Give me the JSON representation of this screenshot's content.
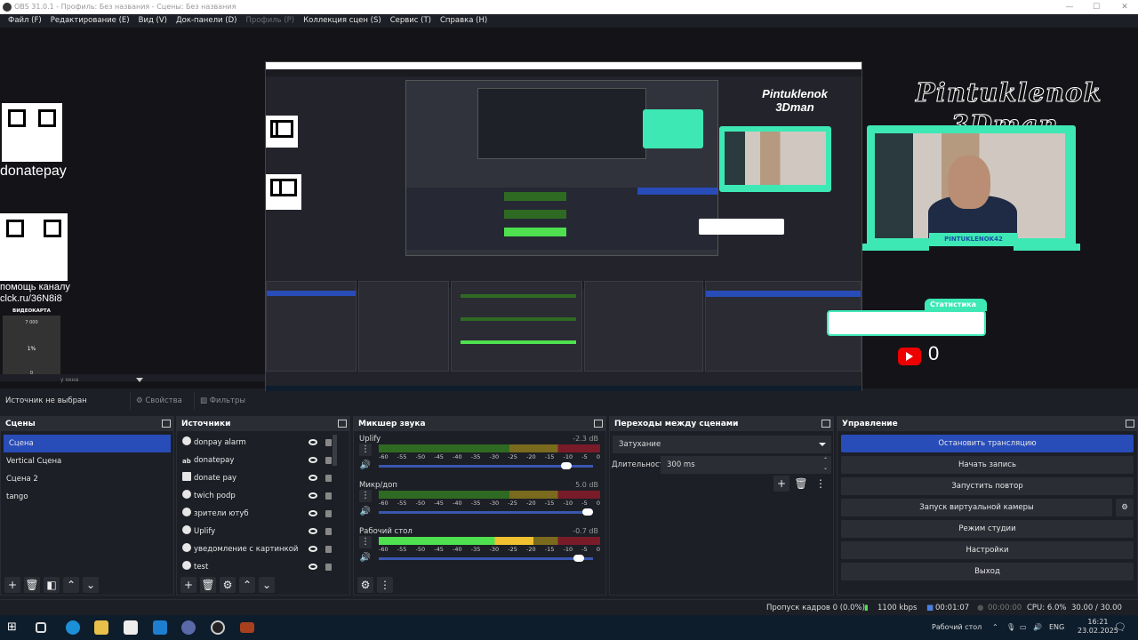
{
  "window": {
    "title": "OBS 31.0.1 - Профиль: Без названия - Сцены: Без названия"
  },
  "menu": [
    {
      "label": "Файл (F)"
    },
    {
      "label": "Редактирование (E)"
    },
    {
      "label": "Вид (V)"
    },
    {
      "label": "Док-панели (D)"
    },
    {
      "label": "Профиль (P)",
      "disabled": true
    },
    {
      "label": "Коллекция сцен (S)"
    },
    {
      "label": "Сервис (T)"
    },
    {
      "label": "Справка (H)"
    }
  ],
  "preview": {
    "qr1_label": "donatepay",
    "qr2_label_1": "помощь каналу",
    "qr2_label_2": "clck.ru/36N8i8",
    "gpu_widget": {
      "title": "ВИДЕОКАРТА",
      "top": "7 000",
      "mid": "1%",
      "bottom": "0"
    },
    "window_fragment": "у окна",
    "logo_line1": "Pintuklenok",
    "logo_line2": "3Dman",
    "cam_label": "PINTUKLENOK42",
    "stats_label": "Статистика",
    "youtube_count": "0",
    "accent": "#3ee8b5"
  },
  "source_row": {
    "no_source": "Источник не выбран",
    "properties": "Свойства",
    "filters": "Фильтры"
  },
  "scenes": {
    "title": "Сцены",
    "items": [
      "Сцена",
      "Vertical Сцена",
      "Сцена 2",
      "tango"
    ],
    "selected": 0
  },
  "sources": {
    "title": "Источники",
    "items": [
      {
        "name": "donpay alarm",
        "icon": "globe-icon"
      },
      {
        "name": "donatepay",
        "icon": "text-icon"
      },
      {
        "name": "donate pay",
        "icon": "image-icon"
      },
      {
        "name": "twich podp",
        "icon": "globe-icon"
      },
      {
        "name": "зрители ютуб",
        "icon": "globe-icon"
      },
      {
        "name": "Uplify",
        "icon": "globe-icon"
      },
      {
        "name": "уведомление с картинкой",
        "icon": "globe-icon"
      },
      {
        "name": "test",
        "icon": "globe-icon"
      }
    ]
  },
  "mixer": {
    "title": "Микшер звука",
    "ticks": [
      "-60",
      "-55",
      "-50",
      "-45",
      "-40",
      "-35",
      "-30",
      "-25",
      "-20",
      "-15",
      "-10",
      "-5",
      "0"
    ],
    "channels": [
      {
        "name": "Uplify",
        "db": "-2.3 dB",
        "volume_pct": 90,
        "level_pct": 0
      },
      {
        "name": "Микр/доп",
        "db": "5.0 dB",
        "volume_pct": 100,
        "level_pct": 0
      },
      {
        "name": "Рабочий стол",
        "db": "-0.7 dB",
        "volume_pct": 96,
        "level_pct": 70
      }
    ]
  },
  "transitions": {
    "title": "Переходы между сценами",
    "selected": "Затухание",
    "duration_label": "Длительность",
    "duration": "300 ms"
  },
  "controls": {
    "title": "Управление",
    "buttons": [
      "Остановить трансляцию",
      "Начать запись",
      "Запустить повтор",
      "Запуск виртуальной камеры",
      "Режим студии",
      "Настройки",
      "Выход"
    ],
    "accent": "#284cb8"
  },
  "status": {
    "dropped": "Пропуск кадров 0 (0.0%)",
    "bitrate": "1100 kbps",
    "stream_time": "00:01:07",
    "rec_time": "00:00:00",
    "cpu": "CPU: 6.0%",
    "fps": "30.00 / 30.00 FPS"
  },
  "taskbar": {
    "desktop": "Рабочий стол",
    "lang": "ENG",
    "time": "16:21",
    "date": "23.02.2025"
  }
}
